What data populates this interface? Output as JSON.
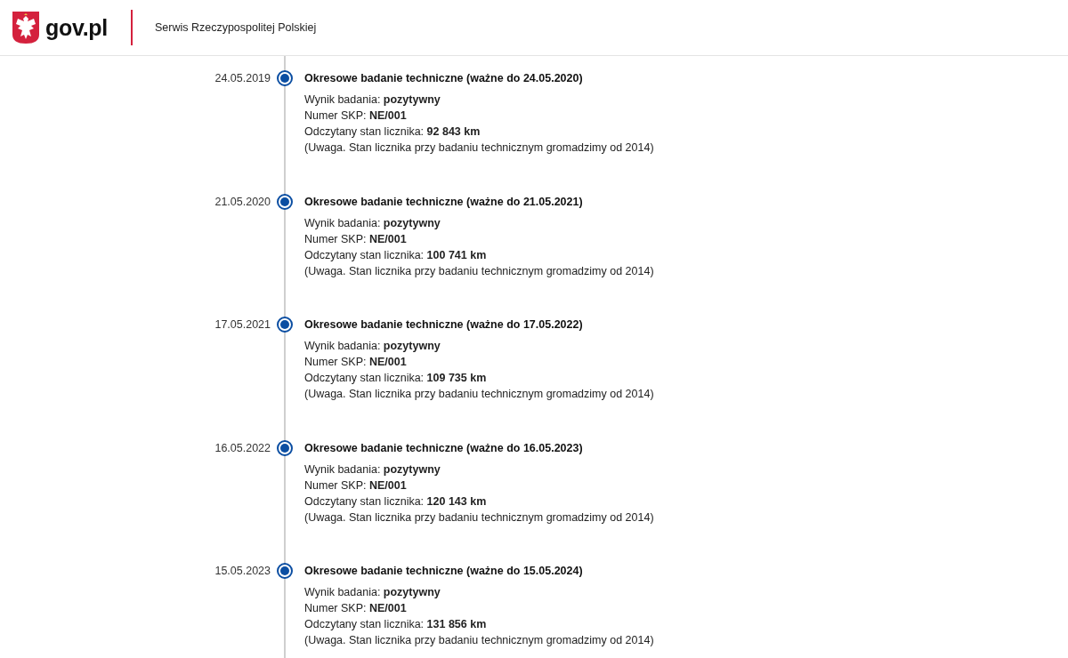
{
  "header": {
    "logo_text": "gov.pl",
    "subtitle": "Serwis Rzeczypospolitej Polskiej"
  },
  "timeline": [
    {
      "date": "24.05.2019",
      "title": "Okresowe badanie techniczne (ważne do 24.05.2020)",
      "lines": [
        "Wynik badania: **pozytywny**",
        "Numer SKP: **NE/001**",
        "Odczytany stan licznika: **92 843 km**",
        "(Uwaga. Stan licznika przy badaniu technicznym gromadzimy od 2014)"
      ]
    },
    {
      "date": "21.05.2020",
      "title": "Okresowe badanie techniczne (ważne do 21.05.2021)",
      "lines": [
        "Wynik badania: **pozytywny**",
        "Numer SKP: **NE/001**",
        "Odczytany stan licznika: **100 741 km**",
        "(Uwaga. Stan licznika przy badaniu technicznym gromadzimy od 2014)"
      ]
    },
    {
      "date": "17.05.2021",
      "title": "Okresowe badanie techniczne (ważne do 17.05.2022)",
      "lines": [
        "Wynik badania: **pozytywny**",
        "Numer SKP: **NE/001**",
        "Odczytany stan licznika: **109 735 km**",
        "(Uwaga. Stan licznika przy badaniu technicznym gromadzimy od 2014)"
      ]
    },
    {
      "date": "16.05.2022",
      "title": "Okresowe badanie techniczne (ważne do 16.05.2023)",
      "lines": [
        "Wynik badania: **pozytywny**",
        "Numer SKP: **NE/001**",
        "Odczytany stan licznika: **120 143 km**",
        "(Uwaga. Stan licznika przy badaniu technicznym gromadzimy od 2014)"
      ]
    },
    {
      "date": "15.05.2023",
      "title": "Okresowe badanie techniczne (ważne do 15.05.2024)",
      "lines": [
        "Wynik badania: **pozytywny**",
        "Numer SKP: **NE/001**",
        "Odczytany stan licznika: **131 856 km**",
        "(Uwaga. Stan licznika przy badaniu technicznym gromadzimy od 2014)"
      ]
    }
  ]
}
